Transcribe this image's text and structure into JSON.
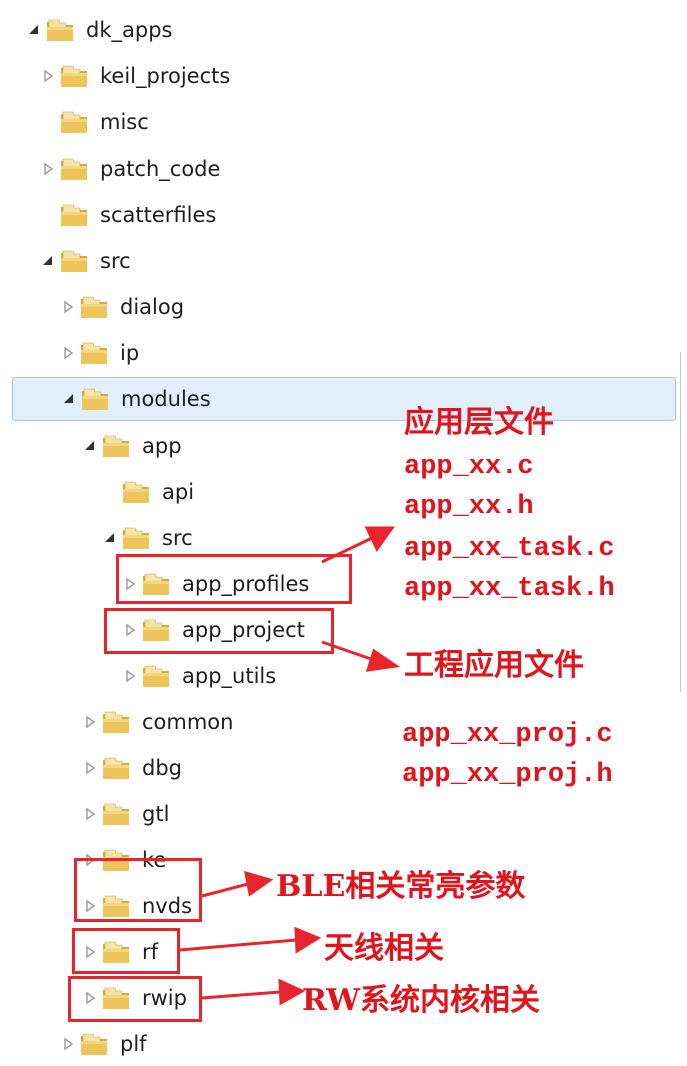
{
  "tree": {
    "items": [
      {
        "name": "dk_apps",
        "expanded": true
      },
      {
        "name": "keil_projects",
        "expanded": false
      },
      {
        "name": "misc",
        "expanded": null
      },
      {
        "name": "patch_code",
        "expanded": false
      },
      {
        "name": "scatterfiles",
        "expanded": null
      },
      {
        "name": "src",
        "expanded": true
      },
      {
        "name": "dialog",
        "expanded": false
      },
      {
        "name": "ip",
        "expanded": false
      },
      {
        "name": "modules",
        "expanded": true,
        "selected": true
      },
      {
        "name": "app",
        "expanded": true
      },
      {
        "name": "api",
        "expanded": null
      },
      {
        "name": "src",
        "expanded": true
      },
      {
        "name": "app_profiles",
        "expanded": false
      },
      {
        "name": "app_project",
        "expanded": false
      },
      {
        "name": "app_utils",
        "expanded": false
      },
      {
        "name": "common",
        "expanded": false
      },
      {
        "name": "dbg",
        "expanded": false
      },
      {
        "name": "gtl",
        "expanded": false
      },
      {
        "name": "ke",
        "expanded": false
      },
      {
        "name": "nvds",
        "expanded": false
      },
      {
        "name": "rf",
        "expanded": false
      },
      {
        "name": "rwip",
        "expanded": false
      },
      {
        "name": "plf",
        "expanded": false
      }
    ]
  },
  "annotations": {
    "app_layer": {
      "title": "应用层文件",
      "files": [
        "app_xx.c",
        "app_xx.h",
        "app_xx_task.c",
        "app_xx_task.h"
      ]
    },
    "project_layer": {
      "title": "工程应用文件",
      "files": [
        "app_xx_proj.c",
        "app_xx_proj.h"
      ]
    },
    "nvds_note": "BLE相关常亮参数",
    "rf_note": "天线相关",
    "rwip_note": "RW系统内核相关"
  },
  "colors": {
    "annotation": "#e0141c",
    "selection": "#e3eefb",
    "folder": "#e9c25a"
  }
}
